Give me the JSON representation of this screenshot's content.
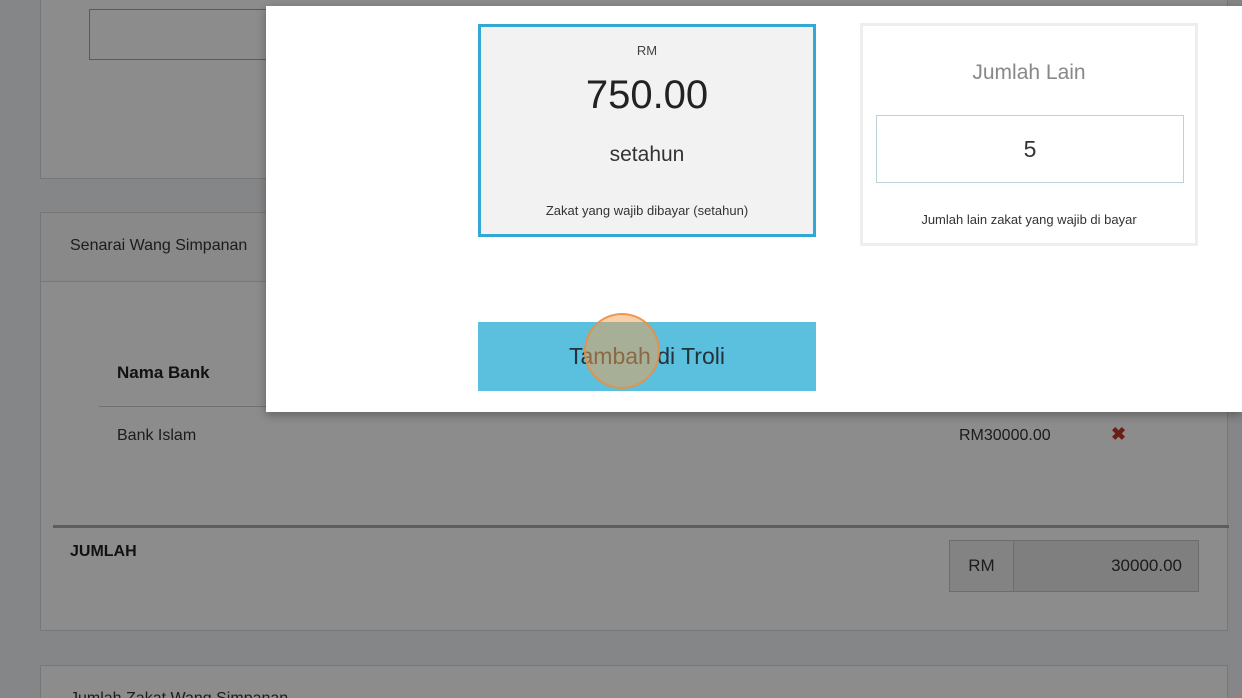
{
  "background": {
    "savings_list_title": "Senarai Wang Simpanan",
    "table": {
      "header_bank": "Nama Bank",
      "rows": [
        {
          "bank": "Bank Islam",
          "amount": "RM30000.00",
          "delete_glyph": "✖"
        }
      ]
    },
    "total": {
      "label": "JUMLAH",
      "currency": "RM",
      "value": "30000.00"
    },
    "bottom_panel_title": "Jumlah Zakat Wang Simpanan"
  },
  "modal": {
    "main_card": {
      "currency": "RM",
      "amount": "750.00",
      "period": "setahun",
      "description": "Zakat yang wajib dibayar (setahun)"
    },
    "other_card": {
      "title": "Jumlah Lain",
      "input_value": "5",
      "description": "Jumlah lain zakat yang wajib di bayar"
    },
    "add_button_label": "Tambah di Troli"
  },
  "colors": {
    "selected_card_border": "#33a8d6",
    "add_button_bg": "#5bc0de",
    "delete_icon": "#c0392b",
    "click_indicator": "#f4a050"
  },
  "icons": {
    "delete": "close-icon"
  }
}
